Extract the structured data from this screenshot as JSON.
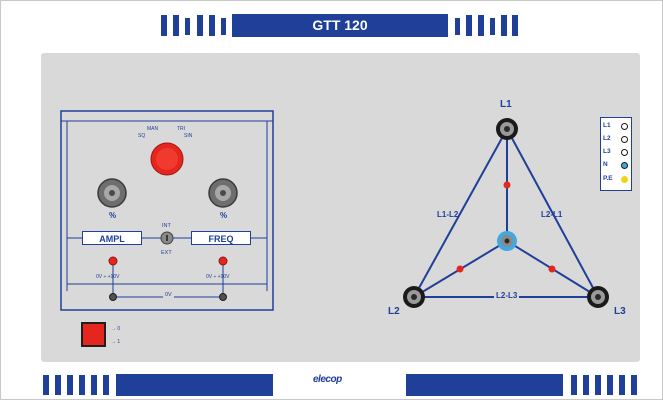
{
  "header": {
    "title": "GTT 120"
  },
  "footer": {
    "logo": "elecop"
  },
  "generator": {
    "knob_labels": [
      "MAN",
      "TRI",
      "SQ",
      "SIN"
    ],
    "left_knob_caption": "%",
    "right_knob_caption": "%",
    "ampl_label": "AMPL",
    "freq_label": "FREQ",
    "int_label": "INT",
    "ext_label": "EXT",
    "left_range": "0V ÷ +10V",
    "right_range": "0V ÷ +10V",
    "zero_label": "0V",
    "switch_label_top": "→ 0",
    "switch_label_bottom": "→ 1"
  },
  "triangle": {
    "node_l1": "L1",
    "node_l2": "L2",
    "node_l3": "L3",
    "edge_l1_l2": "L1-L2",
    "edge_l2_l1": "L2-L1",
    "edge_l2_l3": "L2-L3"
  },
  "legend": {
    "rows": [
      {
        "label": "L1",
        "symbol": "terminal-black"
      },
      {
        "label": "L2",
        "symbol": "terminal-black"
      },
      {
        "label": "L3",
        "symbol": "terminal-black"
      },
      {
        "label": "N",
        "symbol": "terminal-blue"
      },
      {
        "label": "P.E",
        "symbol": "terminal-yellow"
      }
    ]
  },
  "colors": {
    "brand_blue": "#1f3f99",
    "panel_gray": "#d9d9d9",
    "accent_red": "#e4261f",
    "neutral_blue": "#3fa9e0",
    "pe_yellow": "#f2d31b"
  }
}
